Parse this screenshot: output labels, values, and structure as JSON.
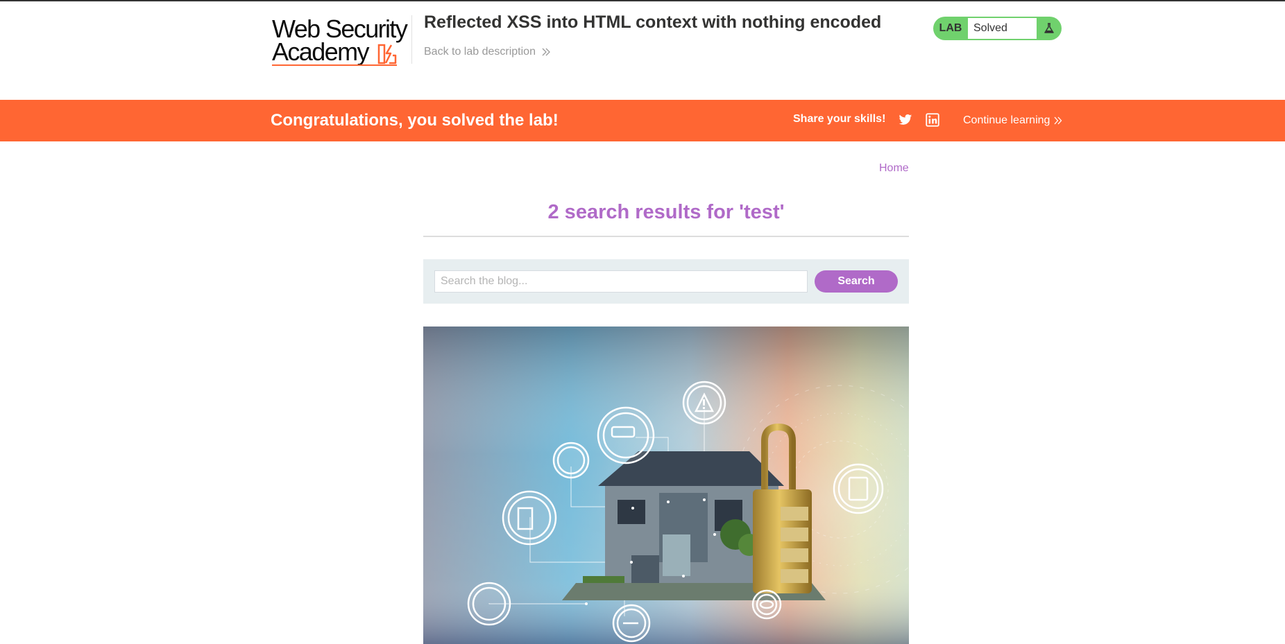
{
  "academy": {
    "logo": {
      "line1": "Web Security",
      "line2": "Academy"
    },
    "lab_title": "Reflected XSS into HTML context with nothing encoded",
    "back_link": "Back to lab description",
    "lab_badge": {
      "label": "LAB",
      "status": "Solved",
      "icon": "flask-icon"
    }
  },
  "banner": {
    "message": "Congratulations, you solved the lab!",
    "share_label": "Share your skills!",
    "social_icons": [
      "twitter-icon",
      "linkedin-icon"
    ],
    "continue_label": "Continue learning",
    "color": "#ff6633"
  },
  "blog": {
    "nav": {
      "home": "Home"
    },
    "results_heading": "2 search results for 'test'",
    "search": {
      "placeholder": "Search the blog...",
      "value": "",
      "button_label": "Search"
    },
    "post_image": {
      "description": "house-security-icons-illustration"
    }
  },
  "colors": {
    "accent": "#b06ac8",
    "lab_solved": "#70d16d",
    "brand_orange": "#ff6633"
  }
}
